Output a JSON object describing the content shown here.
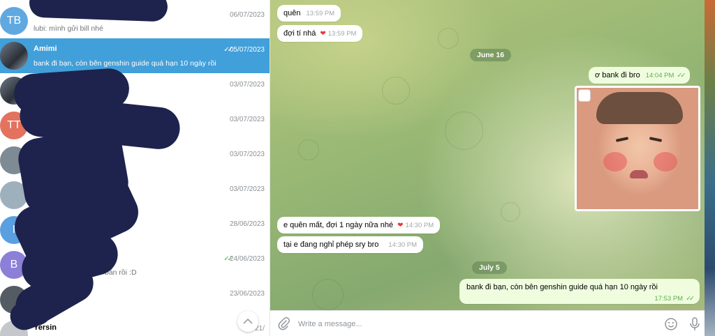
{
  "sidebar": {
    "chats": [
      {
        "avatar": "TB",
        "avatar_color": "#5fa9e0",
        "name": "",
        "preview": "lubi: mình gửi bill nhé",
        "date": "06/07/2023",
        "read": false
      },
      {
        "avatar": "",
        "avatar_color": "#3a3f47",
        "name": "Amimi",
        "preview": "bank đi bạn, còn bên genshin guide quá hạn 10 ngày rồi",
        "date": "05/07/2023",
        "read": true
      },
      {
        "avatar": "",
        "avatar_color": "#8a6f5d",
        "name": "",
        "preview": "",
        "date": "03/07/2023",
        "read": false
      },
      {
        "avatar": "TT",
        "avatar_color": "#e3725e",
        "name": "",
        "preview": "",
        "date": "03/07/2023",
        "read": false
      },
      {
        "avatar": "",
        "avatar_color": "#7e8a94",
        "name": "",
        "preview": "",
        "date": "03/07/2023",
        "read": false
      },
      {
        "avatar": "",
        "avatar_color": "#9fb0bd",
        "name": "",
        "preview": "",
        "date": "03/07/2023",
        "read": false
      },
      {
        "avatar": "I",
        "avatar_color": "#5a9fe0",
        "name": "",
        "preview": "",
        "date": "28/06/2023",
        "read": false
      },
      {
        "avatar": "B",
        "avatar_color": "#8c7fd8",
        "name": "",
        "preview": "bán rồi :D",
        "date": "24/06/2023",
        "read": true
      },
      {
        "avatar": "",
        "avatar_color": "#555b62",
        "name": "",
        "preview": "",
        "date": "23/06/2023",
        "read": false
      },
      {
        "avatar": "",
        "avatar_color": "#c4c7cb",
        "name": "Yersin",
        "preview": "",
        "date": "21/",
        "read": false
      }
    ],
    "scroll_up_icon": "chevron-up-icon"
  },
  "messages": {
    "quen": {
      "text": "quên",
      "time": "13:59 PM"
    },
    "doi_ti": {
      "text": "đợi tí nhá",
      "time": "13:59 PM"
    },
    "june16": "June 16",
    "bank_bro": {
      "text": "ơ bank đi bro",
      "time": "14:04 PM"
    },
    "e_quen": {
      "text": "e quên mất, đợi 1 ngày nữa nhé",
      "time": "14:30 PM"
    },
    "tai_e": {
      "text": "tại e đang nghỉ phép sry bro",
      "time": "14:30 PM"
    },
    "july5": "July 5",
    "bank_ban": {
      "text": "bank đi bạn, còn bên genshin guide quá hạn 10 ngày rồi",
      "time": "17:53 PM"
    }
  },
  "composer": {
    "placeholder": "Write a message...",
    "attach_icon": "paperclip-icon",
    "emoji_icon": "smiley-icon",
    "mic_icon": "microphone-icon"
  },
  "colors": {
    "accent": "#419fd9",
    "outgoing_bubble": "#effdde",
    "heart": "#e23b3b",
    "read_check": "#4fae4e"
  }
}
